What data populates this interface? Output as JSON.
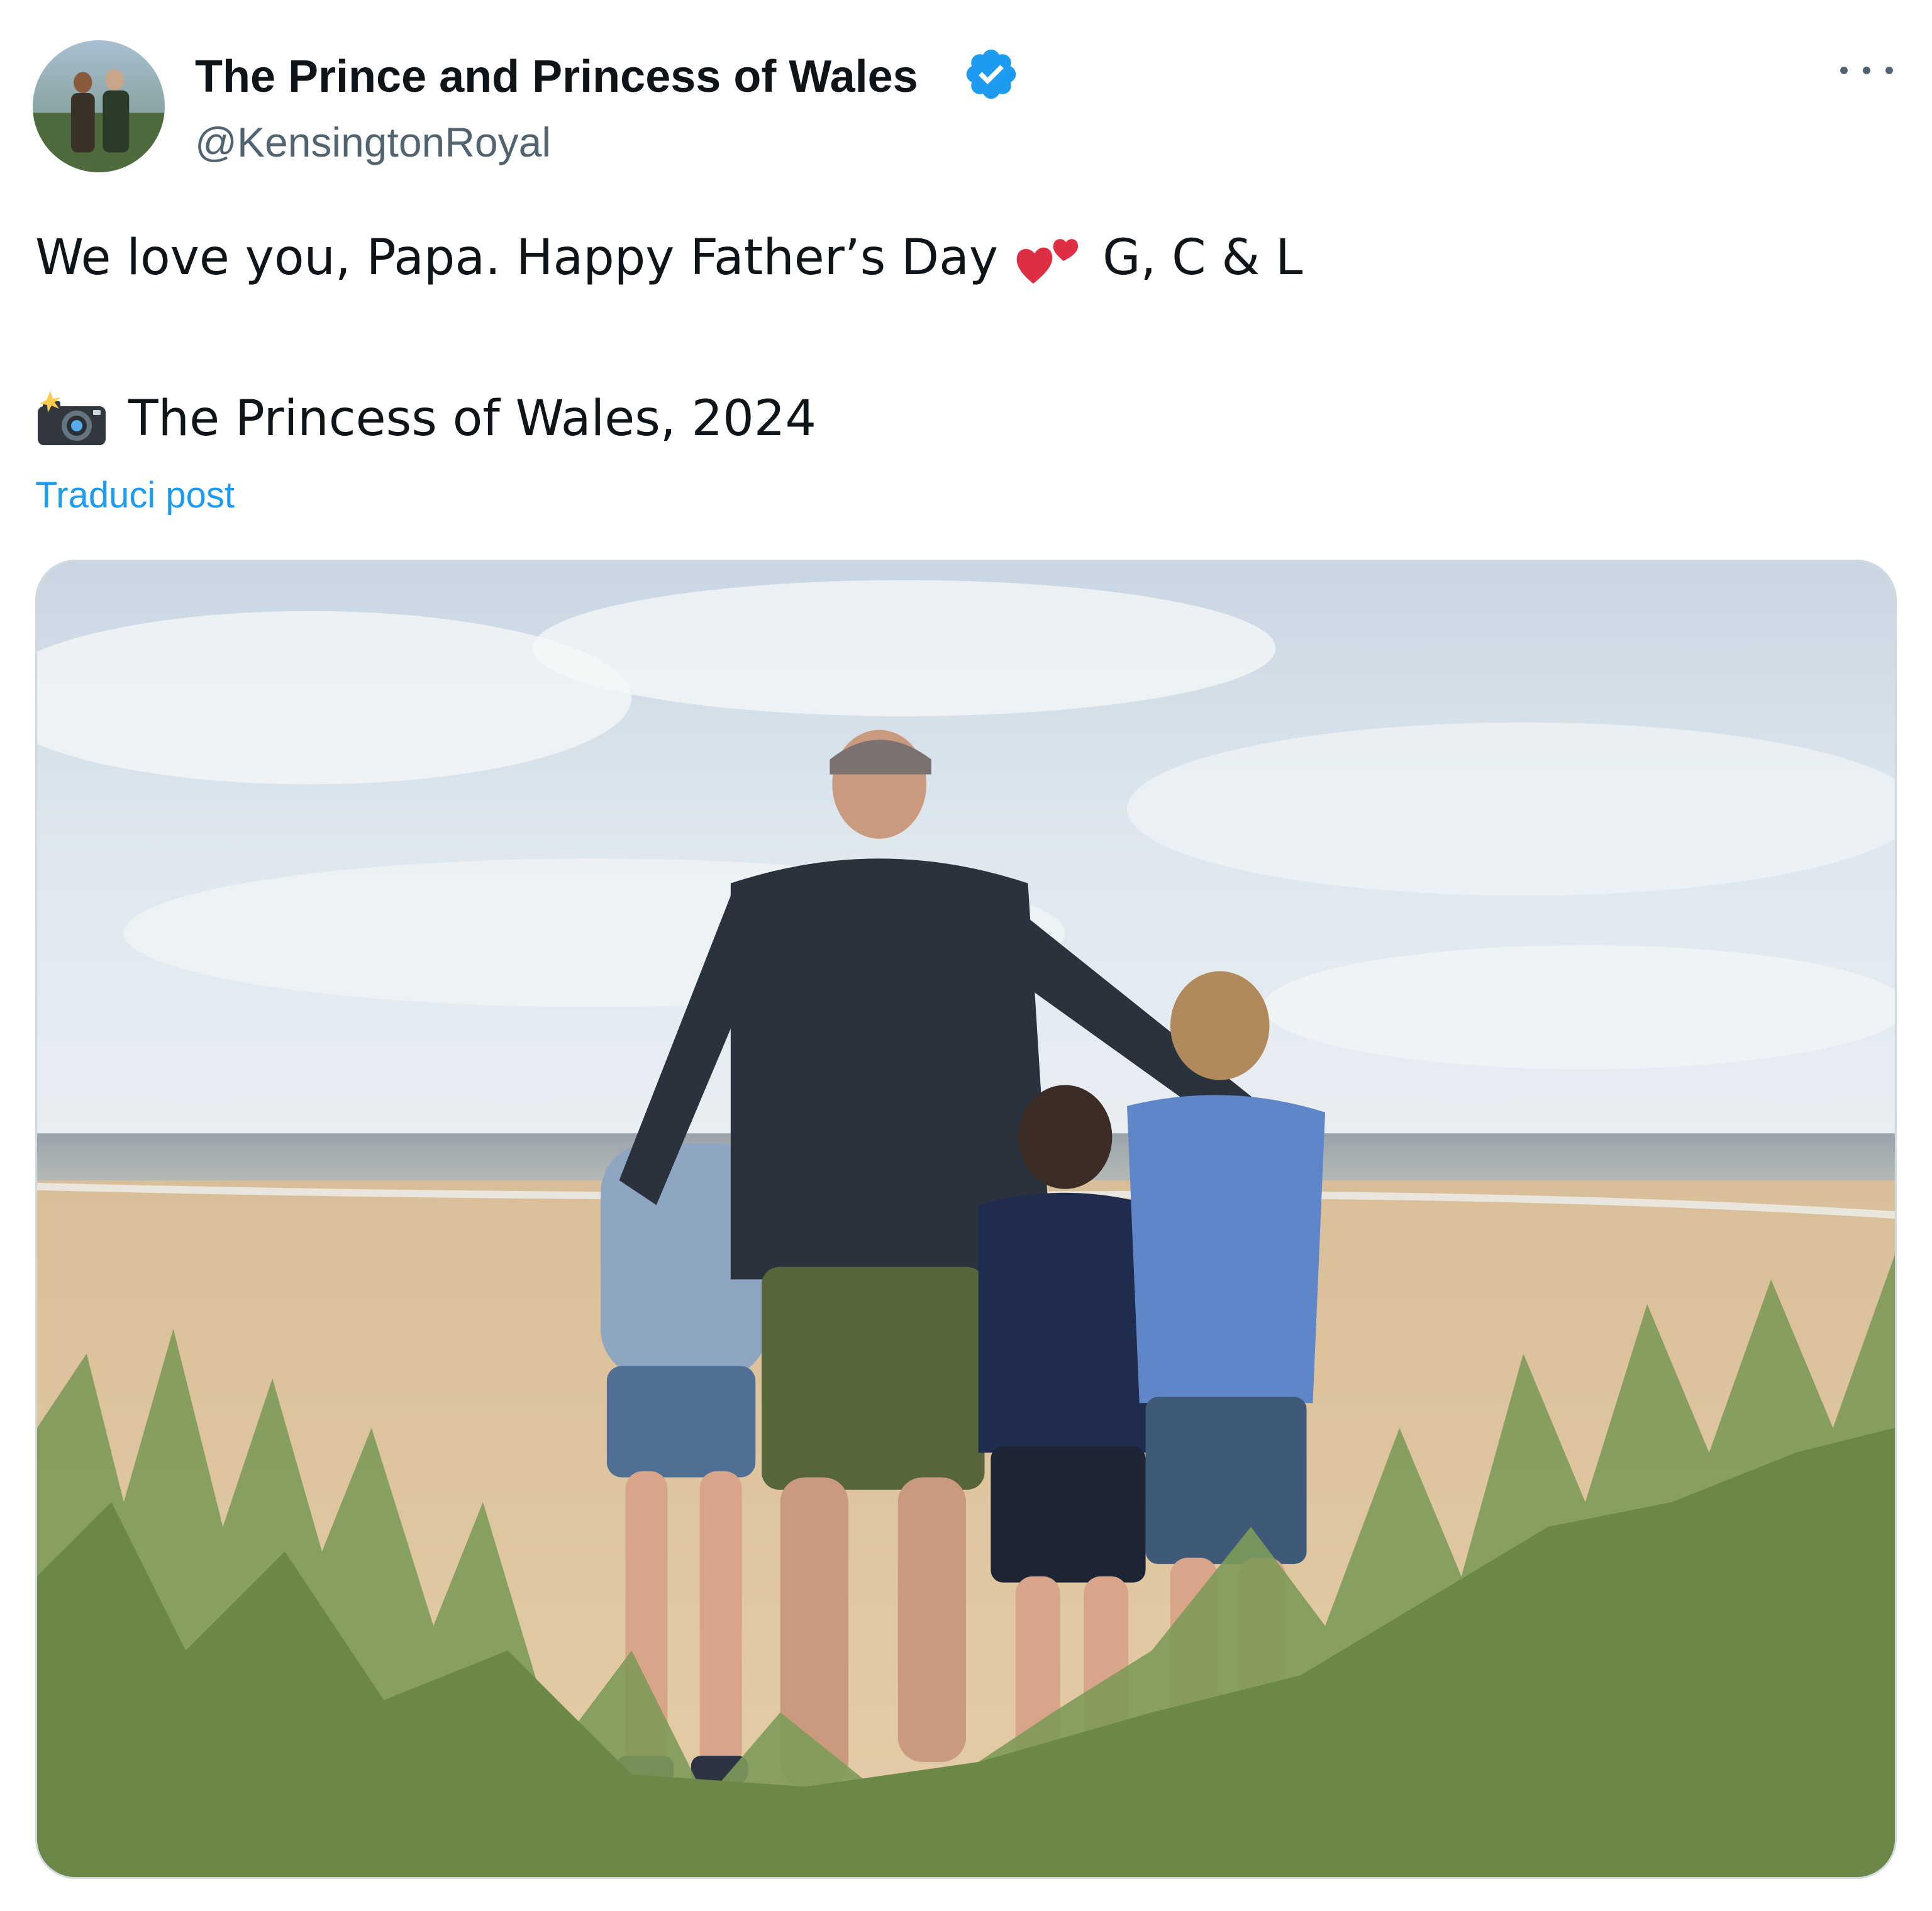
{
  "author": {
    "name": "The Prince and Princess of Wales",
    "handle": "@KensingtonRoyal",
    "verified": true
  },
  "tweet": {
    "line1_text": "We love you, Papa. Happy Father’s Day",
    "line1_emoji": "two-hearts-icon",
    "line1_signoff": "G, C & L",
    "line2_emoji": "camera-with-flash-icon",
    "line2_text": "The Princess of Wales, 2024"
  },
  "translate_label": "Traduci post",
  "colors": {
    "text": "#0f1419",
    "secondary": "#536471",
    "link": "#1d9bf0",
    "verified": "#1d9bf0"
  }
}
